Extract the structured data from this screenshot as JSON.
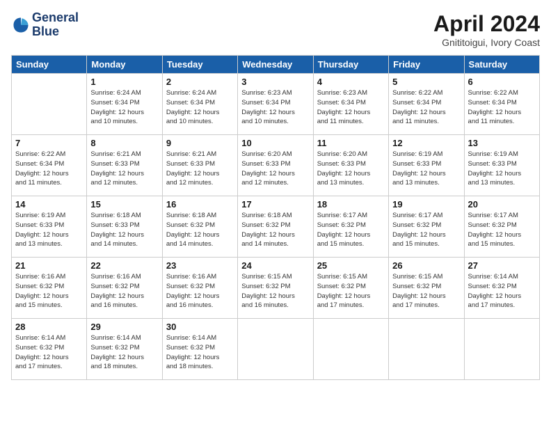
{
  "logo": {
    "line1": "General",
    "line2": "Blue"
  },
  "title": "April 2024",
  "location": "Gnititoigui, Ivory Coast",
  "weekdays": [
    "Sunday",
    "Monday",
    "Tuesday",
    "Wednesday",
    "Thursday",
    "Friday",
    "Saturday"
  ],
  "weeks": [
    [
      {
        "day": "",
        "info": ""
      },
      {
        "day": "1",
        "info": "Sunrise: 6:24 AM\nSunset: 6:34 PM\nDaylight: 12 hours\nand 10 minutes."
      },
      {
        "day": "2",
        "info": "Sunrise: 6:24 AM\nSunset: 6:34 PM\nDaylight: 12 hours\nand 10 minutes."
      },
      {
        "day": "3",
        "info": "Sunrise: 6:23 AM\nSunset: 6:34 PM\nDaylight: 12 hours\nand 10 minutes."
      },
      {
        "day": "4",
        "info": "Sunrise: 6:23 AM\nSunset: 6:34 PM\nDaylight: 12 hours\nand 11 minutes."
      },
      {
        "day": "5",
        "info": "Sunrise: 6:22 AM\nSunset: 6:34 PM\nDaylight: 12 hours\nand 11 minutes."
      },
      {
        "day": "6",
        "info": "Sunrise: 6:22 AM\nSunset: 6:34 PM\nDaylight: 12 hours\nand 11 minutes."
      }
    ],
    [
      {
        "day": "7",
        "info": "Sunrise: 6:22 AM\nSunset: 6:34 PM\nDaylight: 12 hours\nand 11 minutes."
      },
      {
        "day": "8",
        "info": "Sunrise: 6:21 AM\nSunset: 6:33 PM\nDaylight: 12 hours\nand 12 minutes."
      },
      {
        "day": "9",
        "info": "Sunrise: 6:21 AM\nSunset: 6:33 PM\nDaylight: 12 hours\nand 12 minutes."
      },
      {
        "day": "10",
        "info": "Sunrise: 6:20 AM\nSunset: 6:33 PM\nDaylight: 12 hours\nand 12 minutes."
      },
      {
        "day": "11",
        "info": "Sunrise: 6:20 AM\nSunset: 6:33 PM\nDaylight: 12 hours\nand 13 minutes."
      },
      {
        "day": "12",
        "info": "Sunrise: 6:19 AM\nSunset: 6:33 PM\nDaylight: 12 hours\nand 13 minutes."
      },
      {
        "day": "13",
        "info": "Sunrise: 6:19 AM\nSunset: 6:33 PM\nDaylight: 12 hours\nand 13 minutes."
      }
    ],
    [
      {
        "day": "14",
        "info": "Sunrise: 6:19 AM\nSunset: 6:33 PM\nDaylight: 12 hours\nand 13 minutes."
      },
      {
        "day": "15",
        "info": "Sunrise: 6:18 AM\nSunset: 6:33 PM\nDaylight: 12 hours\nand 14 minutes."
      },
      {
        "day": "16",
        "info": "Sunrise: 6:18 AM\nSunset: 6:32 PM\nDaylight: 12 hours\nand 14 minutes."
      },
      {
        "day": "17",
        "info": "Sunrise: 6:18 AM\nSunset: 6:32 PM\nDaylight: 12 hours\nand 14 minutes."
      },
      {
        "day": "18",
        "info": "Sunrise: 6:17 AM\nSunset: 6:32 PM\nDaylight: 12 hours\nand 15 minutes."
      },
      {
        "day": "19",
        "info": "Sunrise: 6:17 AM\nSunset: 6:32 PM\nDaylight: 12 hours\nand 15 minutes."
      },
      {
        "day": "20",
        "info": "Sunrise: 6:17 AM\nSunset: 6:32 PM\nDaylight: 12 hours\nand 15 minutes."
      }
    ],
    [
      {
        "day": "21",
        "info": "Sunrise: 6:16 AM\nSunset: 6:32 PM\nDaylight: 12 hours\nand 15 minutes."
      },
      {
        "day": "22",
        "info": "Sunrise: 6:16 AM\nSunset: 6:32 PM\nDaylight: 12 hours\nand 16 minutes."
      },
      {
        "day": "23",
        "info": "Sunrise: 6:16 AM\nSunset: 6:32 PM\nDaylight: 12 hours\nand 16 minutes."
      },
      {
        "day": "24",
        "info": "Sunrise: 6:15 AM\nSunset: 6:32 PM\nDaylight: 12 hours\nand 16 minutes."
      },
      {
        "day": "25",
        "info": "Sunrise: 6:15 AM\nSunset: 6:32 PM\nDaylight: 12 hours\nand 17 minutes."
      },
      {
        "day": "26",
        "info": "Sunrise: 6:15 AM\nSunset: 6:32 PM\nDaylight: 12 hours\nand 17 minutes."
      },
      {
        "day": "27",
        "info": "Sunrise: 6:14 AM\nSunset: 6:32 PM\nDaylight: 12 hours\nand 17 minutes."
      }
    ],
    [
      {
        "day": "28",
        "info": "Sunrise: 6:14 AM\nSunset: 6:32 PM\nDaylight: 12 hours\nand 17 minutes."
      },
      {
        "day": "29",
        "info": "Sunrise: 6:14 AM\nSunset: 6:32 PM\nDaylight: 12 hours\nand 18 minutes."
      },
      {
        "day": "30",
        "info": "Sunrise: 6:14 AM\nSunset: 6:32 PM\nDaylight: 12 hours\nand 18 minutes."
      },
      {
        "day": "",
        "info": ""
      },
      {
        "day": "",
        "info": ""
      },
      {
        "day": "",
        "info": ""
      },
      {
        "day": "",
        "info": ""
      }
    ]
  ]
}
